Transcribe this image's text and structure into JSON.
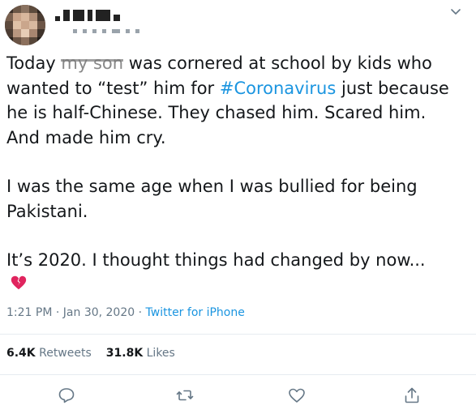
{
  "tweet": {
    "lines_para1": [
      {
        "pre": "Today ",
        "blurred": "my son",
        "post": " was cornered at school by kids who"
      },
      {
        "text": "wanted to “test” him for ",
        "hashtag": "#Coronavirus",
        "after": " just because"
      },
      {
        "text": "he is half-Chinese. They chased him. Scared him."
      },
      {
        "text": "And made him cry."
      }
    ],
    "lines_para2": [
      "I was the same age when I was bullied for being",
      "Pakistani."
    ],
    "line_para3": "It’s 2020. I thought things had changed by now...",
    "emoji": "broken-heart-icon"
  },
  "meta": {
    "time": "1:21 PM",
    "sep1": " · ",
    "date": "Jan 30, 2020",
    "sep2": " · ",
    "source": "Twitter for iPhone"
  },
  "stats": {
    "retweets_count": "6.4K",
    "retweets_label": "Retweets",
    "likes_count": "31.8K",
    "likes_label": "Likes"
  },
  "colors": {
    "link": "#1b95e0",
    "muted": "#657786",
    "heart_red": "#e0245e"
  }
}
